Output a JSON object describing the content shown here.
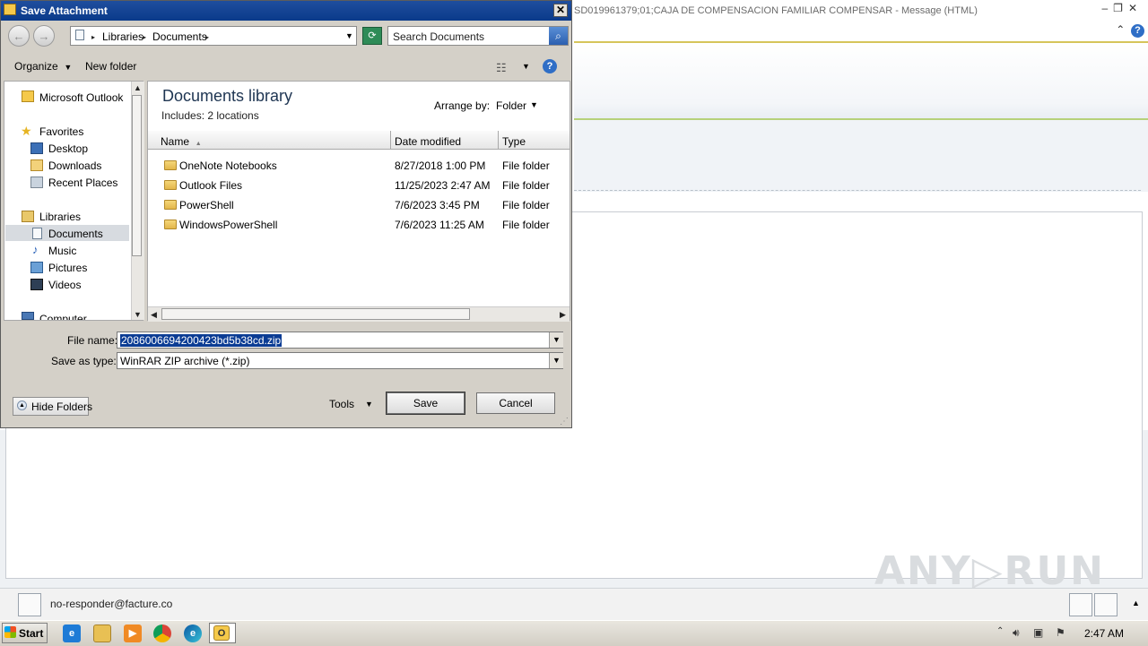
{
  "outlook": {
    "title": "SD019961379;01;CAJA DE COMPENSACION FAMILIAR COMPENSAR -  Message (HTML)",
    "sender_email": "no-responder@facture.co",
    "watermark": "ANY▷RUN"
  },
  "dialog": {
    "title": "Save Attachment",
    "close_glyph": "✕",
    "breadcrumb": [
      "Libraries",
      "Documents"
    ],
    "search_placeholder": "Search Documents",
    "toolbar": {
      "organize_label": "Organize",
      "new_folder_label": "New folder",
      "help_glyph": "?"
    },
    "nav": {
      "microsoft_outlook": "Microsoft Outlook",
      "favorites": "Favorites",
      "desktop": "Desktop",
      "downloads": "Downloads",
      "recent_places": "Recent Places",
      "libraries": "Libraries",
      "documents": "Documents",
      "music": "Music",
      "pictures": "Pictures",
      "videos": "Videos",
      "computer": "Computer"
    },
    "library": {
      "title": "Documents library",
      "subtitle": "Includes:  2 locations",
      "arrange_label": "Arrange by:",
      "arrange_value": "Folder"
    },
    "columns": {
      "name": "Name",
      "date_modified": "Date modified",
      "type": "Type"
    },
    "files": [
      {
        "name": "OneNote Notebooks",
        "date": "8/27/2018 1:00 PM",
        "type": "File folder"
      },
      {
        "name": "Outlook Files",
        "date": "11/25/2023 2:47 AM",
        "type": "File folder"
      },
      {
        "name": "PowerShell",
        "date": "7/6/2023 3:45 PM",
        "type": "File folder"
      },
      {
        "name": "WindowsPowerShell",
        "date": "7/6/2023 11:25 AM",
        "type": "File folder"
      }
    ],
    "form": {
      "file_name_label": "File name:",
      "file_name_value": "2086006694200423bd5b38cd.zip",
      "save_type_label": "Save as type:",
      "save_type_value": "WinRAR ZIP archive (*.zip)"
    },
    "buttons": {
      "hide_folders": "Hide Folders",
      "tools": "Tools",
      "save": "Save",
      "cancel": "Cancel"
    }
  },
  "taskbar": {
    "start_label": "Start",
    "clock": "2:47 AM"
  }
}
